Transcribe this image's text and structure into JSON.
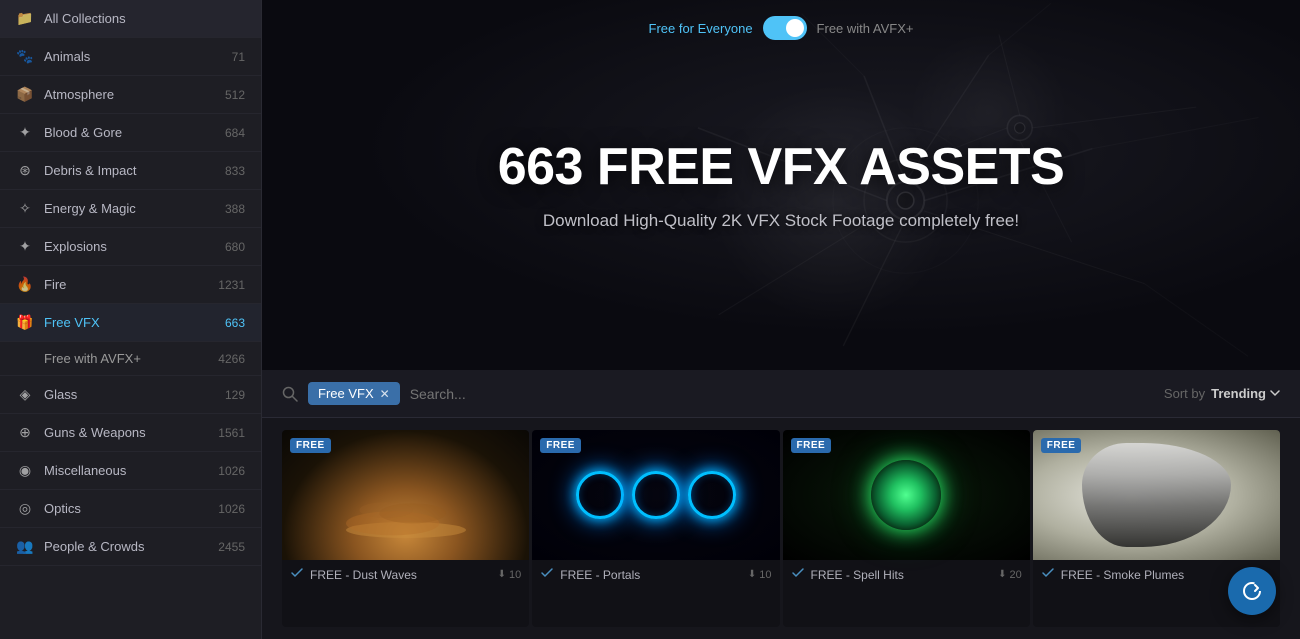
{
  "sidebar": {
    "items": [
      {
        "id": "all-collections",
        "label": "All Collections",
        "count": "",
        "icon": "📁",
        "active": false
      },
      {
        "id": "animals",
        "label": "Animals",
        "count": "71",
        "icon": "🐾",
        "active": false
      },
      {
        "id": "atmosphere",
        "label": "Atmosphere",
        "count": "512",
        "icon": "📦",
        "active": false
      },
      {
        "id": "blood-gore",
        "label": "Blood & Gore",
        "count": "684",
        "icon": "✦",
        "active": false
      },
      {
        "id": "debris-impact",
        "label": "Debris & Impact",
        "count": "833",
        "icon": "⊛",
        "active": false
      },
      {
        "id": "energy-magic",
        "label": "Energy & Magic",
        "count": "388",
        "icon": "✧",
        "active": false
      },
      {
        "id": "explosions",
        "label": "Explosions",
        "count": "680",
        "icon": "✦",
        "active": false
      },
      {
        "id": "fire",
        "label": "Fire",
        "count": "1231",
        "icon": "🔥",
        "active": false
      },
      {
        "id": "free-vfx",
        "label": "Free VFX",
        "count": "663",
        "icon": "🎁",
        "active": true
      },
      {
        "id": "glass",
        "label": "Glass",
        "count": "129",
        "icon": "◈",
        "active": false
      },
      {
        "id": "guns-weapons",
        "label": "Guns & Weapons",
        "count": "1561",
        "icon": "⊕",
        "active": false
      },
      {
        "id": "miscellaneous",
        "label": "Miscellaneous",
        "count": "1026",
        "icon": "◉",
        "active": false
      },
      {
        "id": "optics",
        "label": "Optics",
        "count": "1026",
        "icon": "◎",
        "active": false
      },
      {
        "id": "people-crowds",
        "label": "People & Crowds",
        "count": "2455",
        "icon": "👥",
        "active": false
      }
    ],
    "subitems": [
      {
        "id": "free-with-avfx",
        "label": "Free with AVFX+",
        "count": "4266"
      }
    ]
  },
  "hero": {
    "toggle_left": "Free for Everyone",
    "toggle_right": "Free with AVFX+",
    "title": "663 FREE VFX ASSETS",
    "subtitle": "Download High-Quality 2K VFX Stock Footage completely free!"
  },
  "filterbar": {
    "search_placeholder": "Search...",
    "active_tag": "Free VFX",
    "sort_label": "Sort by",
    "sort_value": "Trending"
  },
  "assets": [
    {
      "id": "dust-waves",
      "badge": "FREE",
      "name": "FREE - Dust Waves",
      "count": "10",
      "thumb": "dust"
    },
    {
      "id": "portals",
      "badge": "FREE",
      "name": "FREE - Portals",
      "count": "10",
      "thumb": "portals"
    },
    {
      "id": "spell-hits",
      "badge": "FREE",
      "name": "FREE - Spell Hits",
      "count": "20",
      "thumb": "spell"
    },
    {
      "id": "smoke-plumes",
      "badge": "FREE",
      "name": "FREE - Smoke Plumes",
      "count": "",
      "thumb": "smoke"
    }
  ],
  "fab": {
    "icon": "↻",
    "label": "Refresh"
  }
}
